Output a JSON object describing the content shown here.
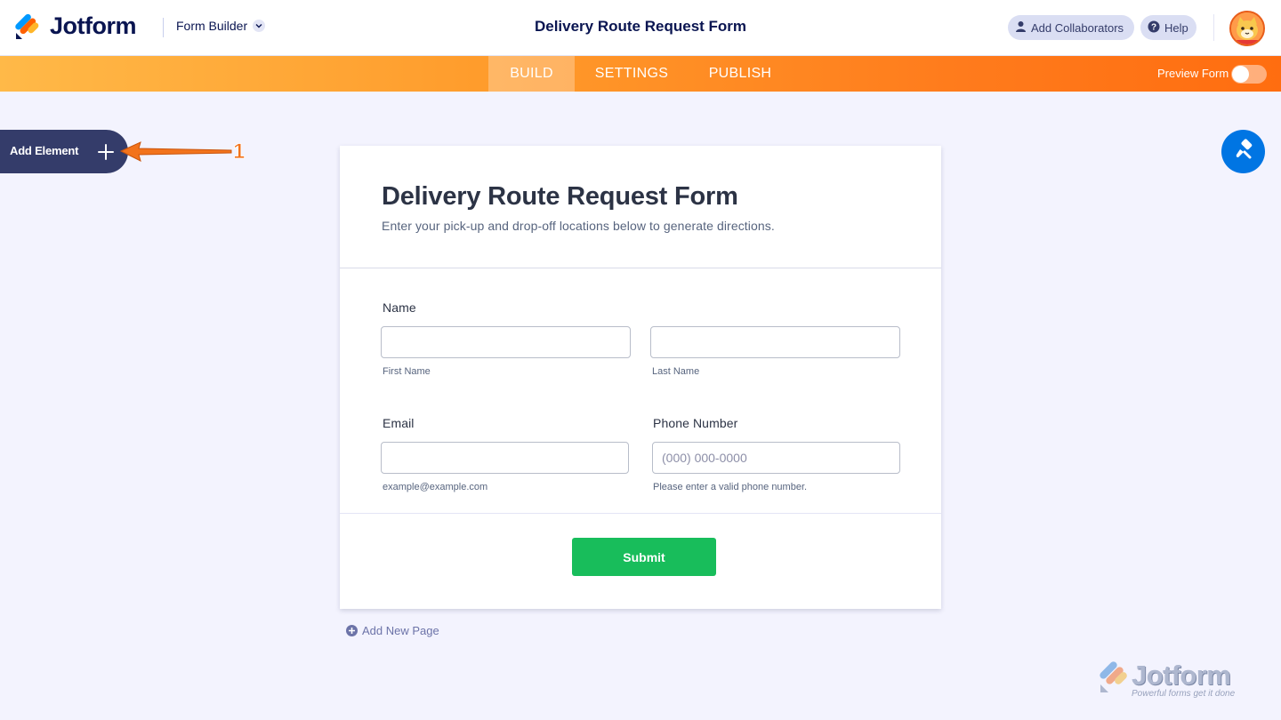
{
  "header": {
    "brand": "Jotform",
    "builder_label": "Form Builder",
    "form_title": "Delivery Route Request Form",
    "add_collaborators": "Add Collaborators",
    "help": "Help"
  },
  "nav": {
    "tabs": [
      {
        "label": "BUILD",
        "active": true
      },
      {
        "label": "SETTINGS",
        "active": false
      },
      {
        "label": "PUBLISH",
        "active": false
      }
    ],
    "preview_label": "Preview Form",
    "preview_on": false
  },
  "sidebar": {
    "add_element": "Add Element",
    "annotation_number": "1"
  },
  "form": {
    "heading": "Delivery Route Request Form",
    "subheading": "Enter your pick-up and drop-off locations below to generate directions.",
    "name": {
      "label": "Name",
      "first_sublabel": "First Name",
      "last_sublabel": "Last Name",
      "first_value": "",
      "last_value": ""
    },
    "email": {
      "label": "Email",
      "sublabel": "example@example.com",
      "value": ""
    },
    "phone": {
      "label": "Phone Number",
      "placeholder": "(000) 000-0000",
      "sublabel": "Please enter a valid phone number.",
      "value": ""
    },
    "submit": "Submit"
  },
  "add_new_page": "Add New Page",
  "watermark": {
    "brand": "Jotform",
    "tagline": "Powerful forms get it done"
  },
  "colors": {
    "nav_gradient_start": "#ffb948",
    "nav_gradient_end": "#ff6d10",
    "submit_green": "#18bd5b",
    "paint_blue": "#0075e3",
    "dark_navy": "#343c6a",
    "annotation_orange": "#f2731c"
  },
  "icons": {
    "logo": "jotform-logo-icon",
    "chevron": "chevron-down-icon",
    "user": "user-icon",
    "help": "help-icon",
    "avatar": "avatar-icon",
    "plus": "plus-icon",
    "arrow": "annotation-arrow-icon",
    "paint": "paint-roller-icon",
    "add_page": "plus-circle-icon"
  }
}
